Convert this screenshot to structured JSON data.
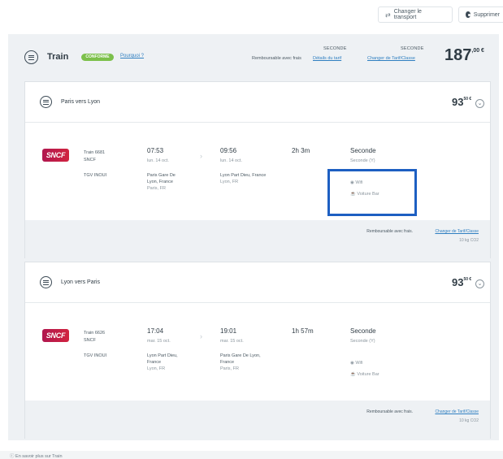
{
  "topbar": {
    "change_transport": "Changer le transport",
    "delete": "Supprimer"
  },
  "summary": {
    "title": "Train",
    "badge": "CONFORME",
    "why_link": "Pourquoi ?",
    "fare_label_1": "SECONDE",
    "fare_label_2": "SECONDE",
    "refund_text": "Remboursable avec frais",
    "details_link": "Détails du tarif",
    "change_class_link": "Changer de Tarif/Classe",
    "total_main": "187",
    "total_cents": ",00 €"
  },
  "legs": [
    {
      "title": "Paris vers Lyon",
      "price_main": "93",
      "price_cents": "50 €",
      "train_no": "Train 6681",
      "operator": "SNCF",
      "service": "TGV INOUI",
      "dep_time": "07:53",
      "dep_date": "lun. 14 oct.",
      "dep_station_1": "Paris Gare De",
      "dep_station_2": "Lyon, France",
      "dep_city": "Paris, FR",
      "arr_time": "09:56",
      "arr_date": "lun. 14 oct.",
      "arr_station_1": "Lyon Part Dieu, France",
      "arr_station_2": "",
      "arr_city": "Lyon, FR",
      "duration": "2h 3m",
      "class": "Seconde",
      "class_sub": "Seconde (Y)",
      "amenity_1": "Wifi",
      "amenity_2": "Voiture Bar",
      "foot_refund": "Remboursable avec frais.",
      "foot_change": "Changer de Tarif/Classe",
      "co2": "10 kg CO2"
    },
    {
      "title": "Lyon vers Paris",
      "price_main": "93",
      "price_cents": "50 €",
      "train_no": "Train 6626",
      "operator": "SNCF",
      "service": "TGV INOUI",
      "dep_time": "17:04",
      "dep_date": "mar. 15 oct.",
      "dep_station_1": "Lyon Part Dieu,",
      "dep_station_2": "France",
      "dep_city": "Lyon, FR",
      "arr_time": "19:01",
      "arr_date": "mar. 15 oct.",
      "arr_station_1": "Paris Gare De Lyon,",
      "arr_station_2": "France",
      "arr_city": "Paris, FR",
      "duration": "1h 57m",
      "class": "Seconde",
      "class_sub": "Seconde (Y)",
      "amenity_1": "Wifi",
      "amenity_2": "Voiture Bar",
      "foot_refund": "Remboursable avec frais.",
      "foot_change": "Changer de Tarif/Classe",
      "co2": "10 kg CO2"
    }
  ],
  "footer": {
    "more_link": "En savoir plus sur Train"
  },
  "colors": {
    "accent_link": "#2f7fc1",
    "badge_green": "#7cc04b",
    "highlight_box": "#1d5fc2",
    "sncf_brand": "#c01d48"
  },
  "icons": [
    "transfer-arrows-icon",
    "gear-icon",
    "train-icon",
    "chevron-down-icon",
    "wifi-icon",
    "bar-car-icon",
    "info-icon"
  ]
}
